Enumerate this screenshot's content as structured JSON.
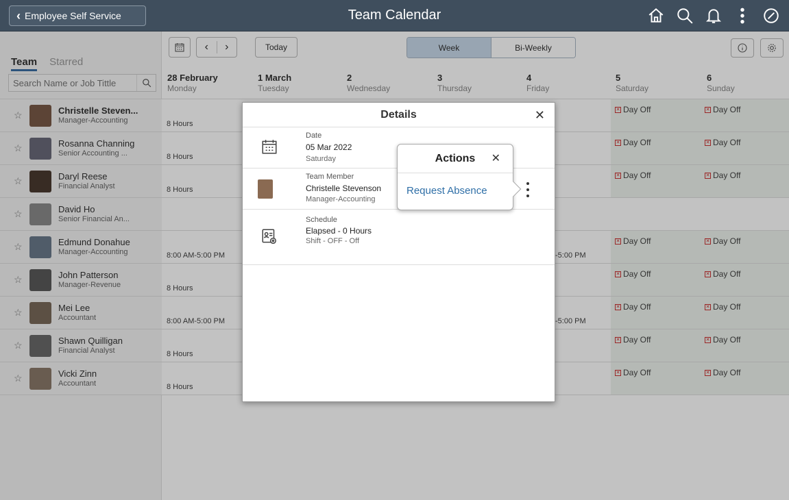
{
  "header": {
    "back_label": "Employee Self Service",
    "title": "Team Calendar",
    "icons": [
      "home-icon",
      "search-icon",
      "bell-icon",
      "kebab-icon",
      "navbar-icon"
    ]
  },
  "left": {
    "tabs": [
      "Team",
      "Starred"
    ],
    "search_placeholder": "Search Name or Job Tittle"
  },
  "toolbar": {
    "today_label": "Today",
    "view_week": "Week",
    "view_biweekly": "Bi-Weekly"
  },
  "days": [
    {
      "date": "28 February",
      "weekday": "Monday"
    },
    {
      "date": "1 March",
      "weekday": "Tuesday"
    },
    {
      "date": "2",
      "weekday": "Wednesday"
    },
    {
      "date": "3",
      "weekday": "Thursday"
    },
    {
      "date": "4",
      "weekday": "Friday"
    },
    {
      "date": "5",
      "weekday": "Saturday"
    },
    {
      "date": "6",
      "weekday": "Sunday"
    }
  ],
  "team": [
    {
      "name": "Christelle Steven...",
      "job": "Manager-Accounting",
      "mon": "8 Hours",
      "fri": "",
      "sat": "Day Off",
      "sun": "Day Off",
      "bold": true
    },
    {
      "name": "Rosanna Channing",
      "job": "Senior Accounting ...",
      "mon": "8 Hours",
      "fri": "",
      "sat": "Day Off",
      "sun": "Day Off",
      "bold": false
    },
    {
      "name": "Daryl Reese",
      "job": "Financial Analyst",
      "mon": "8 Hours",
      "fri": "",
      "sat": "Day Off",
      "sun": "Day Off",
      "bold": false
    },
    {
      "name": "David Ho",
      "job": "Senior Financial An...",
      "mon": "",
      "fri": "",
      "sat": "",
      "sun": "",
      "bold": false
    },
    {
      "name": "Edmund Donahue",
      "job": "Manager-Accounting",
      "mon": "8:00 AM-5:00 PM",
      "fri": "-5:00 PM",
      "sat": "Day Off",
      "sun": "Day Off",
      "bold": false
    },
    {
      "name": "John Patterson",
      "job": "Manager-Revenue",
      "mon": "8 Hours",
      "fri": "",
      "sat": "Day Off",
      "sun": "Day Off",
      "bold": false
    },
    {
      "name": "Mei Lee",
      "job": "Accountant",
      "mon": "8:00 AM-5:00 PM",
      "fri": "-5:00 PM",
      "sat": "Day Off",
      "sun": "Day Off",
      "bold": false
    },
    {
      "name": "Shawn Quilligan",
      "job": "Financial Analyst",
      "mon": "8 Hours",
      "fri": "",
      "sat": "Day Off",
      "sun": "Day Off",
      "bold": false
    },
    {
      "name": "Vicki Zinn",
      "job": "Accountant",
      "mon": "8 Hours",
      "fri": "",
      "sat": "Day Off",
      "sun": "Day Off",
      "bold": false
    }
  ],
  "details": {
    "title": "Details",
    "date_label": "Date",
    "date_value": "05 Mar 2022",
    "date_weekday": "Saturday",
    "member_label": "Team Member",
    "member_name": "Christelle Stevenson",
    "member_job": "Manager-Accounting",
    "schedule_label": "Schedule",
    "schedule_value": "Elapsed - 0 Hours",
    "schedule_shift": "Shift - OFF - Off"
  },
  "actions": {
    "title": "Actions",
    "request_absence": "Request Absence"
  },
  "colors": {
    "header": "#3f4e5d",
    "link": "#2f6fa7",
    "active_segment": "#c8d9ea",
    "weekend": "#eef4ee"
  }
}
